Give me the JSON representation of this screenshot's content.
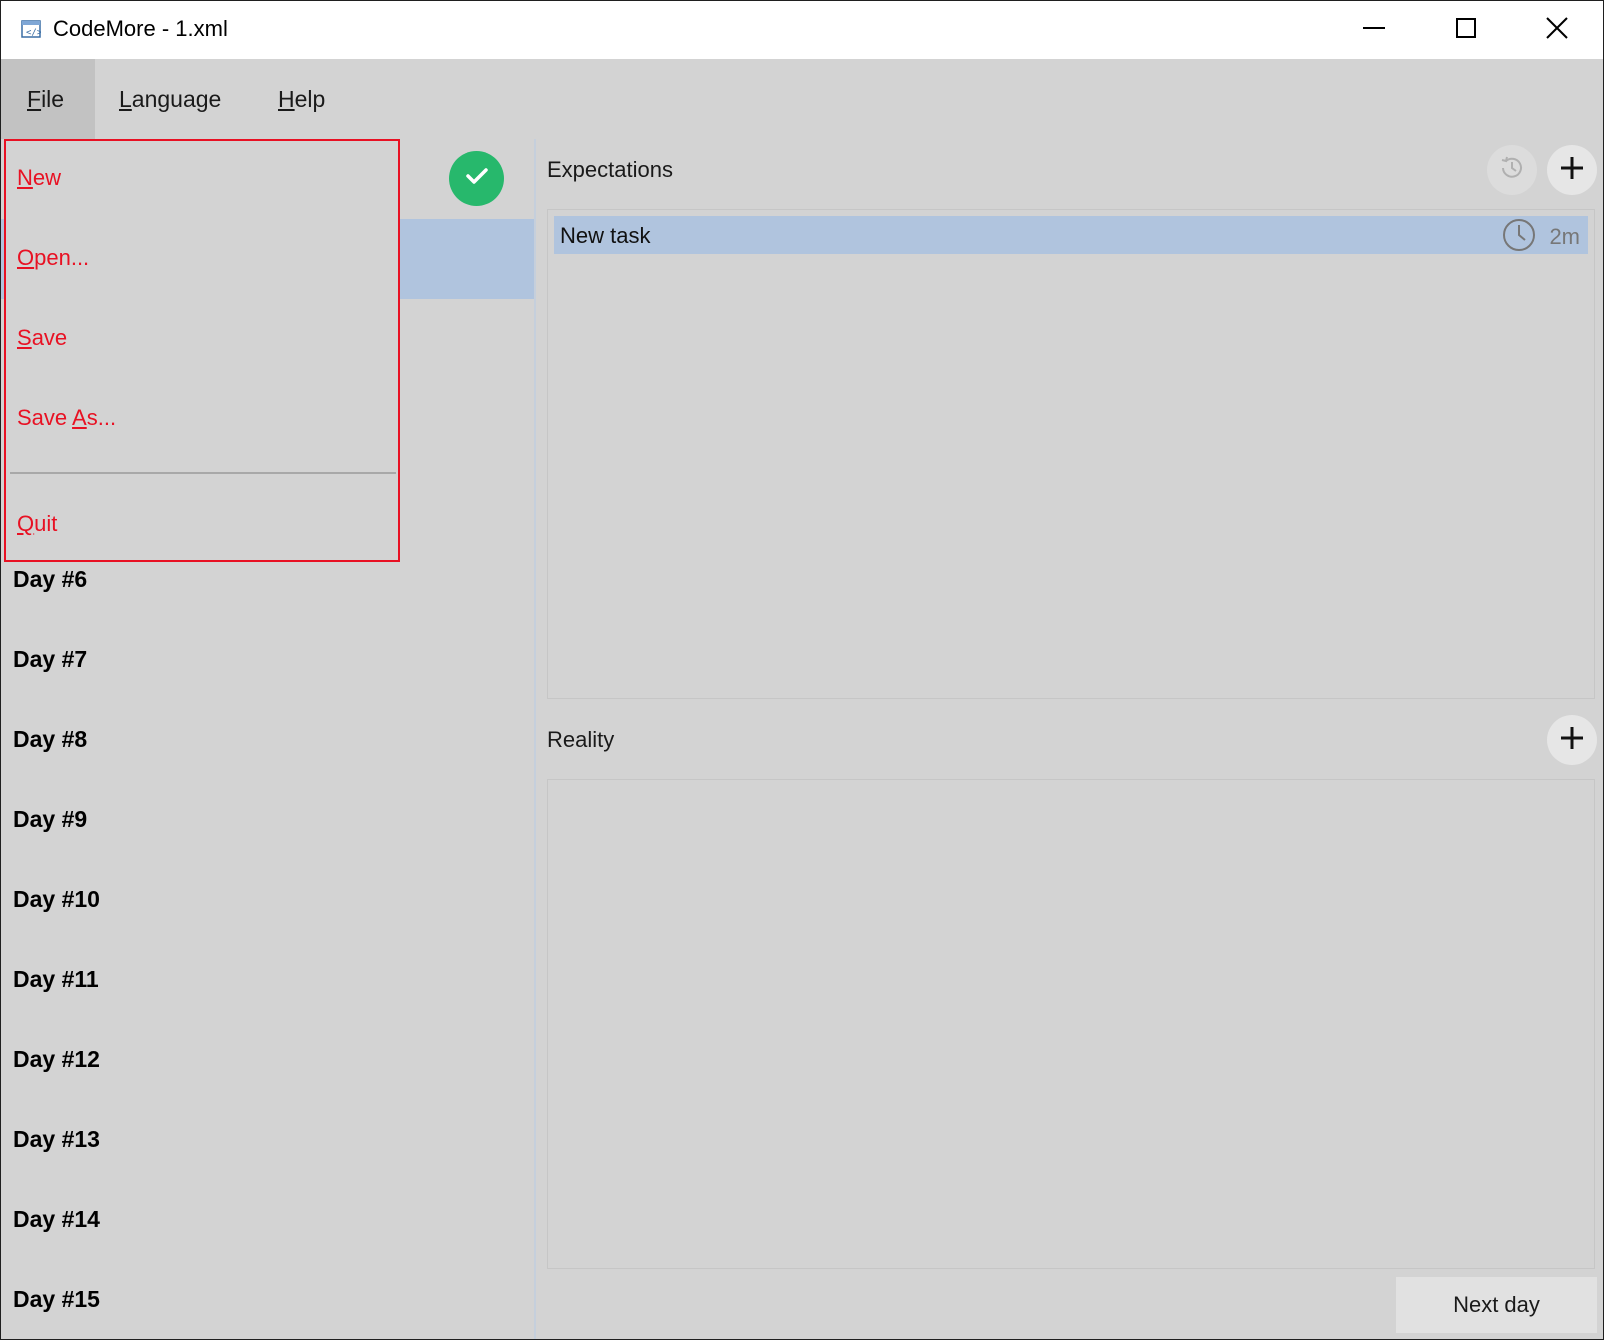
{
  "window": {
    "title": "CodeMore - 1.xml",
    "icon": "app-code-icon",
    "controls": [
      "minimize-icon",
      "maximize-icon",
      "close-icon"
    ]
  },
  "menubar": {
    "items": [
      {
        "label": "File",
        "mnemonic": "F",
        "rest": "ile",
        "active": true
      },
      {
        "label": "Language",
        "mnemonic": "L",
        "rest": "anguage",
        "active": false
      },
      {
        "label": "Help",
        "mnemonic": "H",
        "rest": "elp",
        "active": false
      }
    ]
  },
  "file_menu": {
    "items": [
      {
        "label": "New",
        "pre": "",
        "mnemonic": "N",
        "post": "ew"
      },
      {
        "label": "Open...",
        "pre": "",
        "mnemonic": "O",
        "post": "pen..."
      },
      {
        "label": "Save",
        "pre": "",
        "mnemonic": "S",
        "post": "ave"
      },
      {
        "label": "Save As...",
        "pre": "Save ",
        "mnemonic": "A",
        "post": "s..."
      },
      {
        "label": "Quit",
        "pre": "",
        "mnemonic": "Q",
        "post": "uit"
      }
    ],
    "color": "#e81123"
  },
  "days": {
    "completed_icon": "check-icon",
    "completed_color": "#27b86c",
    "items": [
      "Day #6",
      "Day #7",
      "Day #8",
      "Day #9",
      "Day #10",
      "Day #11",
      "Day #12",
      "Day #13",
      "Day #14",
      "Day #15"
    ]
  },
  "expectations": {
    "title": "Expectations",
    "tasks": [
      {
        "name": "New task",
        "duration": "2m"
      }
    ]
  },
  "reality": {
    "title": "Reality",
    "tasks": []
  },
  "footer": {
    "next_day_label": "Next day"
  },
  "colors": {
    "background": "#d3d3d3",
    "selection": "#b0c4de",
    "highlight_border": "#e81123"
  }
}
